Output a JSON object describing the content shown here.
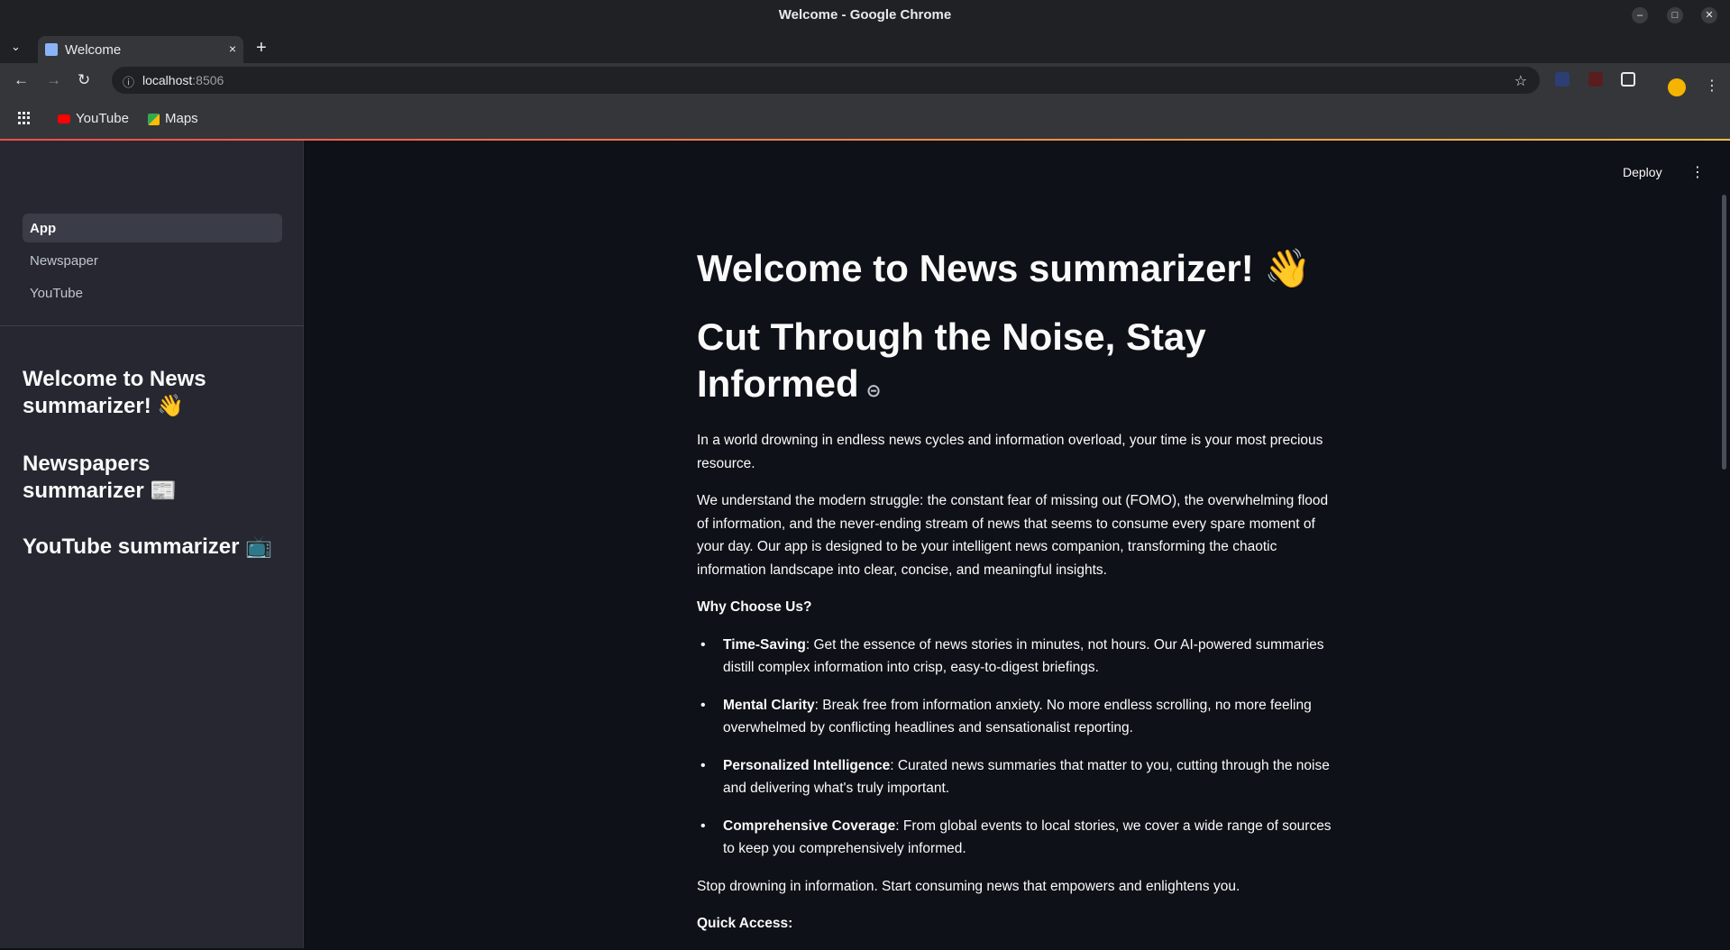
{
  "window": {
    "title": "Welcome - Google Chrome"
  },
  "tab": {
    "label": "Welcome",
    "close": "×"
  },
  "toolbar": {
    "url_host": "localhost",
    "url_port": ":8506"
  },
  "bookmarks": [
    {
      "label": "YouTube",
      "icon": "youtube-icon"
    },
    {
      "label": "Maps",
      "icon": "maps-icon"
    }
  ],
  "app_header": {
    "deploy_label": "Deploy"
  },
  "sidebar": {
    "nav": [
      {
        "label": "App",
        "active": true
      },
      {
        "label": "Newspaper",
        "active": false
      },
      {
        "label": "YouTube",
        "active": false
      }
    ],
    "headings": [
      "Welcome to News summarizer! 👋",
      "Newspapers summarizer 📰",
      "YouTube summarizer 📺"
    ]
  },
  "main": {
    "title": "Welcome to News summarizer! 👋",
    "subtitle": "Cut Through the Noise, Stay Informed",
    "intro": "In a world drowning in endless news cycles and information overload, your time is your most precious resource.",
    "paragraph2": "We understand the modern struggle: the constant fear of missing out (FOMO), the overwhelming flood of information, and the never-ending stream of news that seems to consume every spare moment of your day. Our app is designed to be your intelligent news companion, transforming the chaotic information landscape into clear, concise, and meaningful insights.",
    "why_heading": "Why Choose Us?",
    "features": [
      {
        "name": "Time-Saving",
        "text": ": Get the essence of news stories in minutes, not hours. Our AI-powered summaries distill complex information into crisp, easy-to-digest briefings."
      },
      {
        "name": "Mental Clarity",
        "text": ": Break free from information anxiety. No more endless scrolling, no more feeling overwhelmed by conflicting headlines and sensationalist reporting."
      },
      {
        "name": "Personalized Intelligence",
        "text": ": Curated news summaries that matter to you, cutting through the noise and delivering what's truly important."
      },
      {
        "name": "Comprehensive Coverage",
        "text": ": From global events to local stories, we cover a wide range of sources to keep you comprehensively informed."
      }
    ],
    "closing": "Stop drowning in information. Start consuming news that empowers and enlightens you.",
    "quick_access": "Quick Access:"
  },
  "colors": {
    "accent_start": "#ff4b4b",
    "accent_end": "#ffbd45",
    "background": "#0e1117",
    "sidebar": "#262730"
  }
}
